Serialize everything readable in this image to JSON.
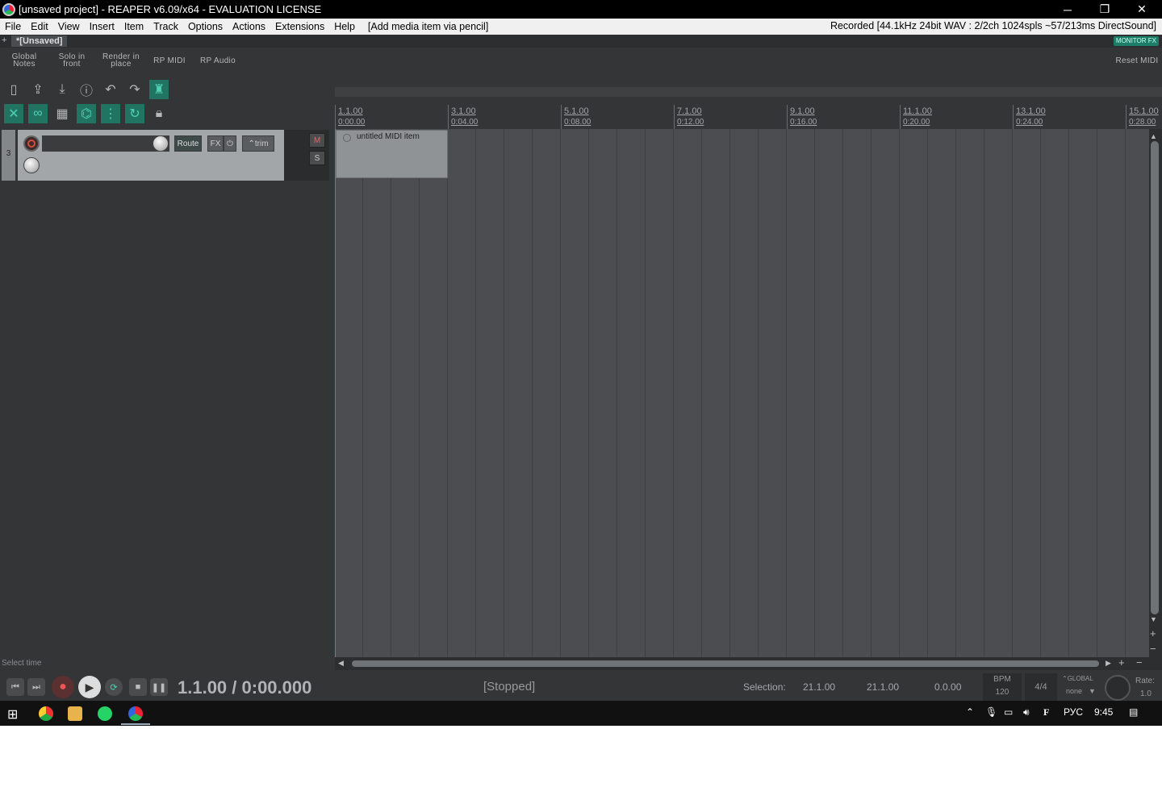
{
  "title": "[unsaved project] - REAPER v6.09/x64 - EVALUATION LICENSE",
  "window_controls": {
    "minimize": "─",
    "maximize": "❐",
    "close": "✕"
  },
  "menu": {
    "file": "File",
    "edit": "Edit",
    "view": "View",
    "insert": "Insert",
    "item": "Item",
    "track": "Track",
    "options": "Options",
    "actions": "Actions",
    "extensions": "Extensions",
    "help": "Help",
    "hint": "[Add media item via pencil]",
    "recorded": "Recorded [44.1kHz 24bit WAV : 2/2ch 1024spls ~57/213ms DirectSound]"
  },
  "project_tab": "*[Unsaved]",
  "tab_plus": "+",
  "monitor_fx": "MONITOR FX",
  "custom_toolbar": {
    "global_notes": [
      "Global",
      "Notes"
    ],
    "solo_front": [
      "Solo in",
      "front"
    ],
    "render_place": [
      "Render in",
      "place"
    ],
    "rp_midi": "RP MIDI",
    "rp_audio": "RP Audio",
    "reset_midi": "Reset MIDI"
  },
  "track": {
    "number": "3",
    "route": "Route",
    "fx": "FX",
    "trim": "trim",
    "mute": "M",
    "solo": "S"
  },
  "ruler": [
    {
      "m": "1.1.00",
      "t": "0:00.00"
    },
    {
      "m": "3.1.00",
      "t": "0:04.00"
    },
    {
      "m": "5.1.00",
      "t": "0:08.00"
    },
    {
      "m": "7.1.00",
      "t": "0:12.00"
    },
    {
      "m": "9.1.00",
      "t": "0:16.00"
    },
    {
      "m": "11.1.00",
      "t": "0:20.00"
    },
    {
      "m": "13.1.00",
      "t": "0:24.00"
    },
    {
      "m": "15.1.00",
      "t": "0:28.00"
    }
  ],
  "midi_item": "untitled MIDI item",
  "status_hint": "Select time",
  "transport": {
    "time": "1.1.00 / 0:00.000",
    "state": "[Stopped]",
    "selection_label": "Selection:",
    "sel_start": "21.1.00",
    "sel_end": "21.1.00",
    "sel_len": "0.0.00",
    "bpm_label": "BPM",
    "bpm": "120",
    "sig": "4/4",
    "global": "GLOBAL",
    "none": "none",
    "rate_label": "Rate:",
    "rate": "1.0"
  },
  "taskbar": {
    "lang": "РУС",
    "clock": "9:45"
  },
  "colors": {
    "accent": "#217462",
    "background": "#333537",
    "item": "#8f9396"
  }
}
